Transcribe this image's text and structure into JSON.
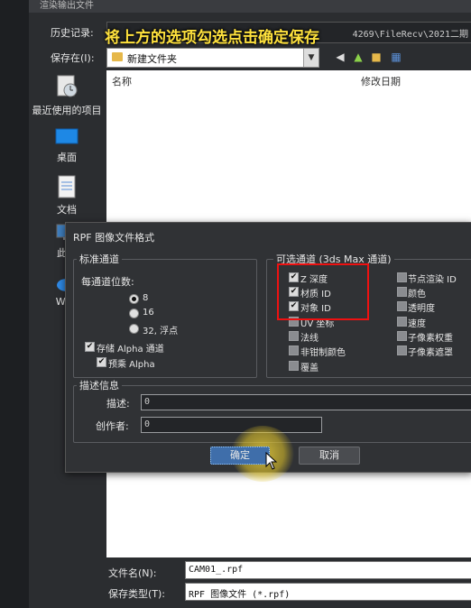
{
  "window": {
    "title": "渲染输出文件"
  },
  "overlay_caption": "将上方的选项勾选点击确定保存",
  "history": {
    "label": "历史记录:",
    "path": "4269\\FileRecv\\2021二期"
  },
  "save_in": {
    "label": "保存在(I):",
    "folder": "新建文件夹"
  },
  "sidebar": {
    "items": [
      {
        "label": "最近使用的项目",
        "icon": "recent-icon"
      },
      {
        "label": "桌面",
        "icon": "desktop-icon"
      },
      {
        "label": "文档",
        "icon": "documents-icon"
      },
      {
        "label": "此电",
        "icon": "computer-icon"
      },
      {
        "label": "WPS",
        "icon": "wps-cloud-icon"
      }
    ]
  },
  "file_list": {
    "col_name": "名称",
    "col_date": "修改日期"
  },
  "filename": {
    "label": "文件名(N):",
    "value": "CAM01_.rpf"
  },
  "filetype": {
    "label": "保存类型(T):",
    "value": "RPF 图像文件 (*.rpf)"
  },
  "rpf_dialog": {
    "title": "RPF 图像文件格式",
    "standard": {
      "title": "标准通道",
      "bits_label": "每通道位数:",
      "bits": [
        {
          "label": "8",
          "checked": true
        },
        {
          "label": "16",
          "checked": false
        },
        {
          "label": "32, 浮点",
          "checked": false
        }
      ],
      "store_alpha": {
        "label": "存储 Alpha 通道",
        "checked": true
      },
      "premultiplied": {
        "label": "预乘 Alpha",
        "checked": true
      }
    },
    "optional": {
      "title": "可选通道 (3ds Max 通道)",
      "left": [
        {
          "label": "Z 深度",
          "checked": true
        },
        {
          "label": "材质 ID",
          "checked": true
        },
        {
          "label": "对象 ID",
          "checked": true
        },
        {
          "label": "UV 坐标",
          "checked": false
        },
        {
          "label": "法线",
          "checked": false
        },
        {
          "label": "非钳制颜色",
          "checked": false
        },
        {
          "label": "覆盖",
          "checked": false
        }
      ],
      "right": [
        {
          "label": "节点渲染 ID",
          "checked": false
        },
        {
          "label": "颜色",
          "checked": false
        },
        {
          "label": "透明度",
          "checked": false
        },
        {
          "label": "速度",
          "checked": false
        },
        {
          "label": "子像素权重",
          "checked": false
        },
        {
          "label": "子像素遮罩",
          "checked": false
        }
      ]
    },
    "description": {
      "title": "描述信息",
      "desc_label": "描述:",
      "desc_value": "0",
      "author_label": "创作者:",
      "author_value": "0"
    },
    "ok_label": "确定",
    "cancel_label": "取消"
  },
  "colors": {
    "highlight_box": "#ee1111",
    "caption": "#ffe23d",
    "cursor_glow": "#ffe13c"
  }
}
